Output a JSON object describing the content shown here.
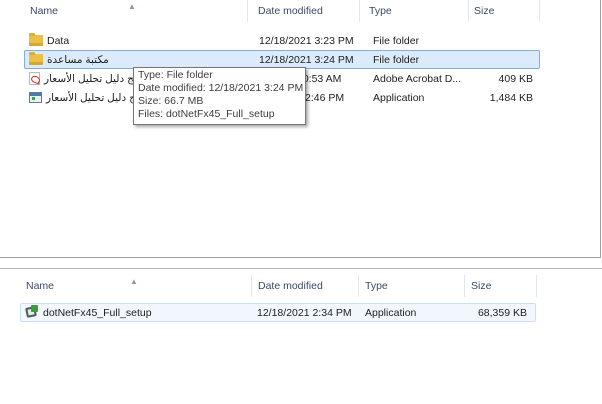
{
  "top_pane": {
    "columns": {
      "name": "Name",
      "date": "Date modified",
      "type": "Type",
      "size": "Size"
    },
    "rows": [
      {
        "name": "Data",
        "date": "12/18/2021 3:23 PM",
        "type": "File folder",
        "size": "",
        "icon": "folder-icon",
        "selected": false
      },
      {
        "name": "مكتبة مساعدة",
        "date": "12/18/2021 3:24 PM",
        "type": "File folder",
        "size": "",
        "icon": "folder-icon",
        "selected": true
      },
      {
        "name": "برنامج دليل تحليل الأسعار",
        "date": "10:53 AM",
        "type": "Adobe Acrobat D...",
        "size": "409 KB",
        "icon": "pdf-icon",
        "selected": false
      },
      {
        "name": "برنامج دليل تحليل الأسعار",
        "date": "2:46 PM",
        "type": "Application",
        "size": "1,484 KB",
        "icon": "app-icon",
        "selected": false
      }
    ],
    "tooltip": {
      "type_line": "Type: File folder",
      "date_line": "Date modified: 12/18/2021 3:24 PM",
      "size_line": "Size: 66.7 MB",
      "files_line": "Files: dotNetFx45_Full_setup"
    }
  },
  "bottom_pane": {
    "columns": {
      "name": "Name",
      "date": "Date modified",
      "type": "Type",
      "size": "Size"
    },
    "rows": [
      {
        "name": "dotNetFx45_Full_setup",
        "date": "12/18/2021 2:34 PM",
        "type": "Application",
        "size": "68,359 KB",
        "icon": "setup-icon",
        "selected": true
      }
    ]
  },
  "colors": {
    "selection_bg": "#dcebfc",
    "selection_border": "#84acdd",
    "header_text": "#3c4a63"
  }
}
